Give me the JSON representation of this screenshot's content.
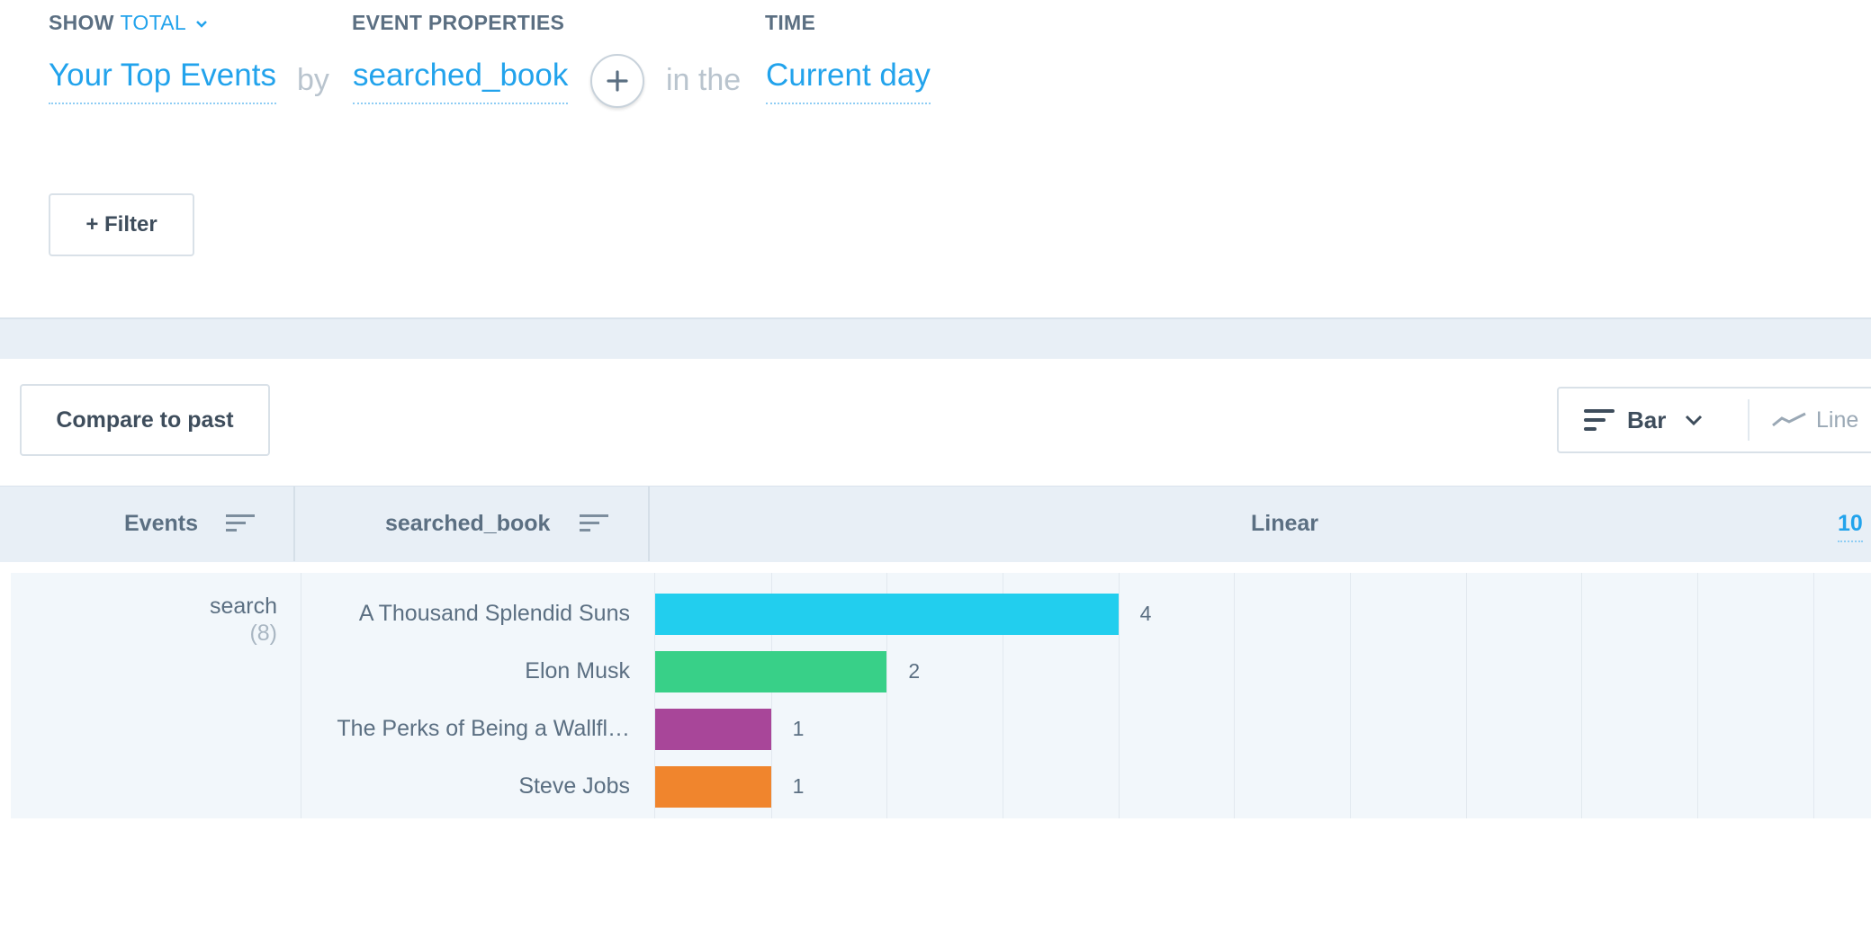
{
  "query": {
    "show_label": "SHOW",
    "show_value": "TOTAL",
    "event_props_label": "EVENT PROPERTIES",
    "time_label": "TIME",
    "events_value": "Your Top Events",
    "by_text": "by",
    "property_value": "searched_book",
    "in_the_text": "in the",
    "time_value": "Current day"
  },
  "filter_button": "+ Filter",
  "compare_button": "Compare to past",
  "chart_toggle": {
    "bar_label": "Bar",
    "line_label": "Line"
  },
  "table": {
    "col_events": "Events",
    "col_property": "searched_book",
    "col_scale": "Linear",
    "col_limit": "10",
    "event_name": "search",
    "event_count": "(8)"
  },
  "colors": {
    "accent": "#22a3ec",
    "bar1": "#22ceee",
    "bar2": "#38d088",
    "bar3": "#a84699",
    "bar4": "#f0852d"
  },
  "chart_data": {
    "type": "bar",
    "orientation": "horizontal",
    "categories": [
      "A Thousand Splendid Suns",
      "Elon Musk",
      "The Perks of Being a Wallfl…",
      "Steve Jobs"
    ],
    "values": [
      4,
      2,
      1,
      1
    ],
    "xlim": [
      0,
      10.5
    ],
    "grid": true
  }
}
